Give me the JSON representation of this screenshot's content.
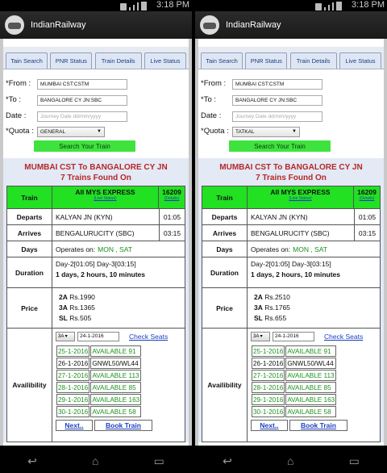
{
  "status": {
    "time": "3:18 PM"
  },
  "app": {
    "title": "IndianRailway"
  },
  "tabs": [
    "Tain Search",
    "PNR Status",
    "Train Details",
    "Live Status"
  ],
  "screens": [
    {
      "form": {
        "from_label": "*From :",
        "from_value": "MUMBAI CST:CSTM",
        "to_label": "*To :",
        "to_value": "BANGALORE CY JN:SBC",
        "date_label": "Date :",
        "date_placeholder": "Journey Date dd/mm/yyyy",
        "quota_label": "*Quota :",
        "quota_value": "GENERAL",
        "search_button": "Search Your Train"
      },
      "route": {
        "line1": "MUMBAI CST To BANGALORE CY JN",
        "line2": "7 Trains Found On"
      },
      "train": {
        "label": "Train",
        "name": "All MYS EXPRESS",
        "live": "(Live Status)",
        "number": "16209",
        "details": "(Details)"
      },
      "departs": {
        "label": "Departs",
        "station": "KALYAN JN (KYN)",
        "time": "01:05"
      },
      "arrives": {
        "label": "Arrives",
        "station": "BENGALURUCITY (SBC)",
        "time": "03:15"
      },
      "days": {
        "label": "Days",
        "prefix": "Operates on:",
        "value": "MON , SAT"
      },
      "duration": {
        "label": "Duration",
        "line1": "Day-2[01:05]  Day-3[03:15]",
        "line2": "1 days, 2 hours, 10 minutes"
      },
      "price": {
        "label": "Price",
        "rows": [
          {
            "cls": "2A",
            "amt": "Rs.1990"
          },
          {
            "cls": "3A",
            "amt": "Rs.1365"
          },
          {
            "cls": "SL",
            "amt": "Rs.505"
          }
        ]
      },
      "availability": {
        "label": "Availibility",
        "class": "3A",
        "date": "24-1-2016",
        "check": "Check Seats",
        "rows": [
          {
            "date": "25-1-2016",
            "status": "AVAILABLE 91",
            "green": true
          },
          {
            "date": "26-1-2016",
            "status": "GNWL50/WL44",
            "green": false
          },
          {
            "date": "27-1-2016",
            "status": "AVAILABLE 113",
            "green": true
          },
          {
            "date": "28-1-2016",
            "status": "AVAILABLE 85",
            "green": true
          },
          {
            "date": "29-1-2016",
            "status": "AVAILABLE 163",
            "green": true
          },
          {
            "date": "30-1-2016",
            "status": "AVAILABLE 58",
            "green": true
          }
        ],
        "next": "Next..",
        "book": "Book Train"
      }
    },
    {
      "form": {
        "from_label": "*From :",
        "from_value": "MUMBAI CST:CSTM",
        "to_label": "*To :",
        "to_value": "BANGALORE CY JN:SBC",
        "date_label": "Date :",
        "date_placeholder": "Journey Date dd/mm/yyyy",
        "quota_label": "*Quota :",
        "quota_value": "TATKAL",
        "search_button": "Search Your Train"
      },
      "route": {
        "line1": "MUMBAI CST To BANGALORE CY JN",
        "line2": "7 Trains Found On"
      },
      "train": {
        "label": "Train",
        "name": "All MYS EXPRESS",
        "live": "(Live Status)",
        "number": "16209",
        "details": "(Details)"
      },
      "departs": {
        "label": "Departs",
        "station": "KALYAN JN (KYN)",
        "time": "01:05"
      },
      "arrives": {
        "label": "Arrives",
        "station": "BENGALURUCITY (SBC)",
        "time": "03:15"
      },
      "days": {
        "label": "Days",
        "prefix": "Operates on:",
        "value": "MON , SAT"
      },
      "duration": {
        "label": "Duration",
        "line1": "Day-2[01:05]  Day-3[03:15]",
        "line2": "1 days, 2 hours, 10 minutes"
      },
      "price": {
        "label": "Price",
        "rows": [
          {
            "cls": "2A",
            "amt": "Rs.2510"
          },
          {
            "cls": "3A",
            "amt": "Rs.1765"
          },
          {
            "cls": "SL",
            "amt": "Rs.655"
          }
        ]
      },
      "availability": {
        "label": "Availibility",
        "class": "3A",
        "date": "24-1-2016",
        "check": "Check Seats",
        "rows": [
          {
            "date": "25-1-2016",
            "status": "AVAILABLE 91",
            "green": true
          },
          {
            "date": "26-1-2016",
            "status": "GNWL50/WL44",
            "green": false
          },
          {
            "date": "27-1-2016",
            "status": "AVAILABLE 113",
            "green": true
          },
          {
            "date": "28-1-2016",
            "status": "AVAILABLE 85",
            "green": true
          },
          {
            "date": "29-1-2016",
            "status": "AVAILABLE 163",
            "green": true
          },
          {
            "date": "30-1-2016",
            "status": "AVAILABLE 58",
            "green": true
          }
        ],
        "next": "Next..",
        "book": "Book Train"
      }
    }
  ]
}
